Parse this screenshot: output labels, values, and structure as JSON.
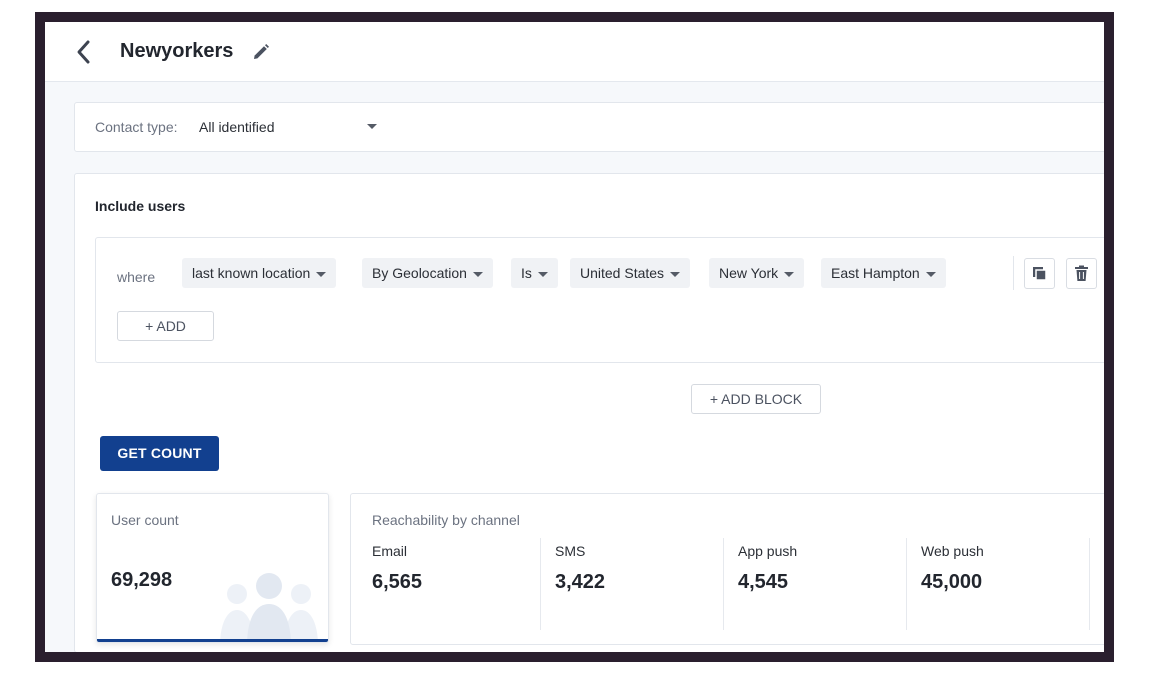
{
  "header": {
    "title": "Newyorkers",
    "back_icon": "chevron-left-icon",
    "edit_icon": "pencil-icon"
  },
  "contact_type": {
    "label": "Contact type:",
    "value": "All identified"
  },
  "include_users": {
    "title": "Include users",
    "where_label": "where",
    "conditions": [
      "last known location",
      "By Geolocation",
      "Is",
      "United States",
      "New York",
      "East Hampton"
    ],
    "copy_icon": "copy-icon",
    "delete_icon": "trash-icon",
    "add_label": "+ ADD",
    "add_block_label": "+ ADD BLOCK"
  },
  "get_count_label": "GET COUNT",
  "user_count": {
    "label": "User count",
    "value": "69,298"
  },
  "reachability": {
    "title": "Reachability by channel",
    "channels": [
      {
        "name": "Email",
        "value": "6,565"
      },
      {
        "name": "SMS",
        "value": "3,422"
      },
      {
        "name": "App push",
        "value": "4,545"
      },
      {
        "name": "Web push",
        "value": "45,000"
      }
    ]
  },
  "colors": {
    "primary": "#12408f",
    "frame": "#2a1f2e",
    "background": "#f6f8fb"
  }
}
